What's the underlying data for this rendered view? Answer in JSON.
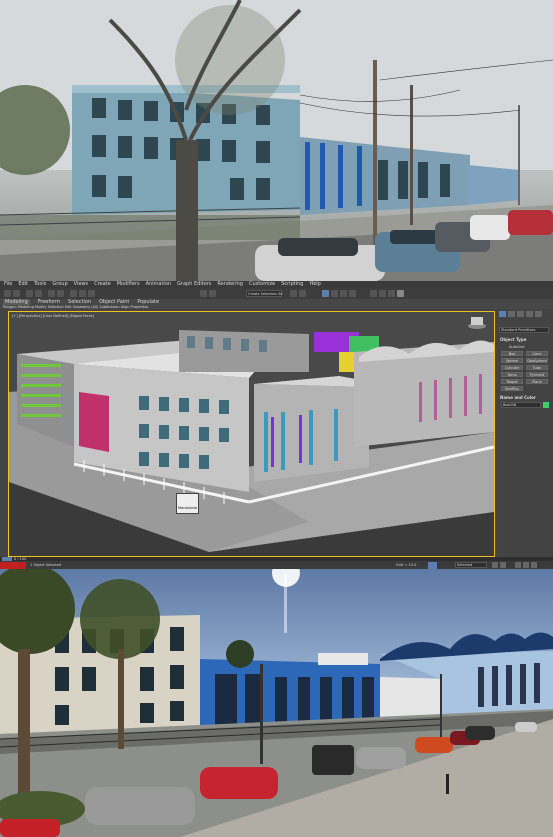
{
  "app": {
    "menu_items": [
      "File",
      "Edit",
      "Tools",
      "Group",
      "Views",
      "Create",
      "Modifiers",
      "Animation",
      "Graph Editors",
      "Rendering",
      "Customize",
      "Scripting",
      "Help"
    ],
    "selection_set": "Create Selection Se",
    "ribbon_tabs": [
      "Modeling",
      "Freeform",
      "Selection",
      "Object Paint",
      "Populate"
    ],
    "ribbon_sub": "Polygon Modeling   Modify Selection   Edit   Geometry (All)   Subdivision   Align   Properties",
    "viewport_label": "[+] [Perspective] [User Defined] [Edged Faces]",
    "viewport_tag": "Macedonia",
    "command_panel": {
      "dropdown": "Standard Primitives",
      "object_type_header": "Object Type",
      "autogrid": "AutoGrid",
      "buttons": [
        "Box",
        "Cone",
        "Sphere",
        "GeoSphere",
        "Cylinder",
        "Tube",
        "Torus",
        "Pyramid",
        "Teapot",
        "Plane",
        "TextPlus"
      ],
      "name_color_header": "Name and Color",
      "name_value": "Box036"
    },
    "timeline": "0 / 100",
    "status": {
      "objects": "1 Object Selected",
      "grid": "Grid = 10.0",
      "mode": "Selected"
    }
  }
}
